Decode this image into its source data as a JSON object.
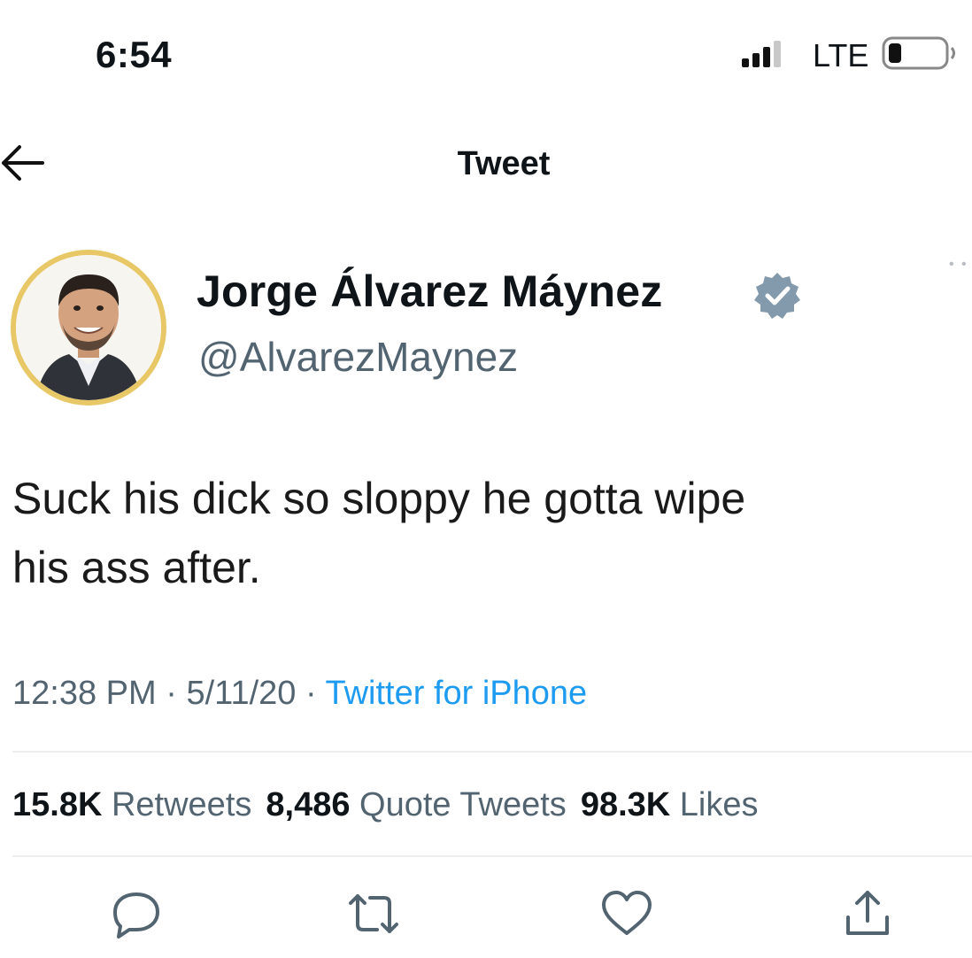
{
  "status_bar": {
    "time": "6:54",
    "network": "LTE",
    "signal_icon": "signal-bars-icon",
    "battery_icon": "battery-low-icon"
  },
  "header": {
    "title": "Tweet",
    "back_icon": "arrow-left-icon"
  },
  "tweet": {
    "author": {
      "display_name": "Jorge Álvarez Máynez",
      "handle": "@AlvarezMaynez",
      "verified_icon": "verified-badge-icon",
      "avatar_ring_color": "#e8c866"
    },
    "text_line1": "Suck his dick so sloppy he gotta wipe",
    "text_line2": "his ass after.",
    "time": "12:38 PM",
    "date": "5/11/20",
    "source": "Twitter for iPhone",
    "separator": "·",
    "stats": {
      "retweets_count": "15.8K",
      "retweets_label": "Retweets",
      "quotes_count": "8,486",
      "quotes_label": "Quote Tweets",
      "likes_count": "98.3K",
      "likes_label": "Likes"
    },
    "actions": [
      "reply-icon",
      "retweet-icon",
      "like-icon",
      "share-icon"
    ]
  },
  "colors": {
    "text": "#0f1419",
    "secondary": "#536471",
    "link": "#1d9bf0",
    "verified_badge": "#829aab",
    "divider": "#eceef0"
  }
}
